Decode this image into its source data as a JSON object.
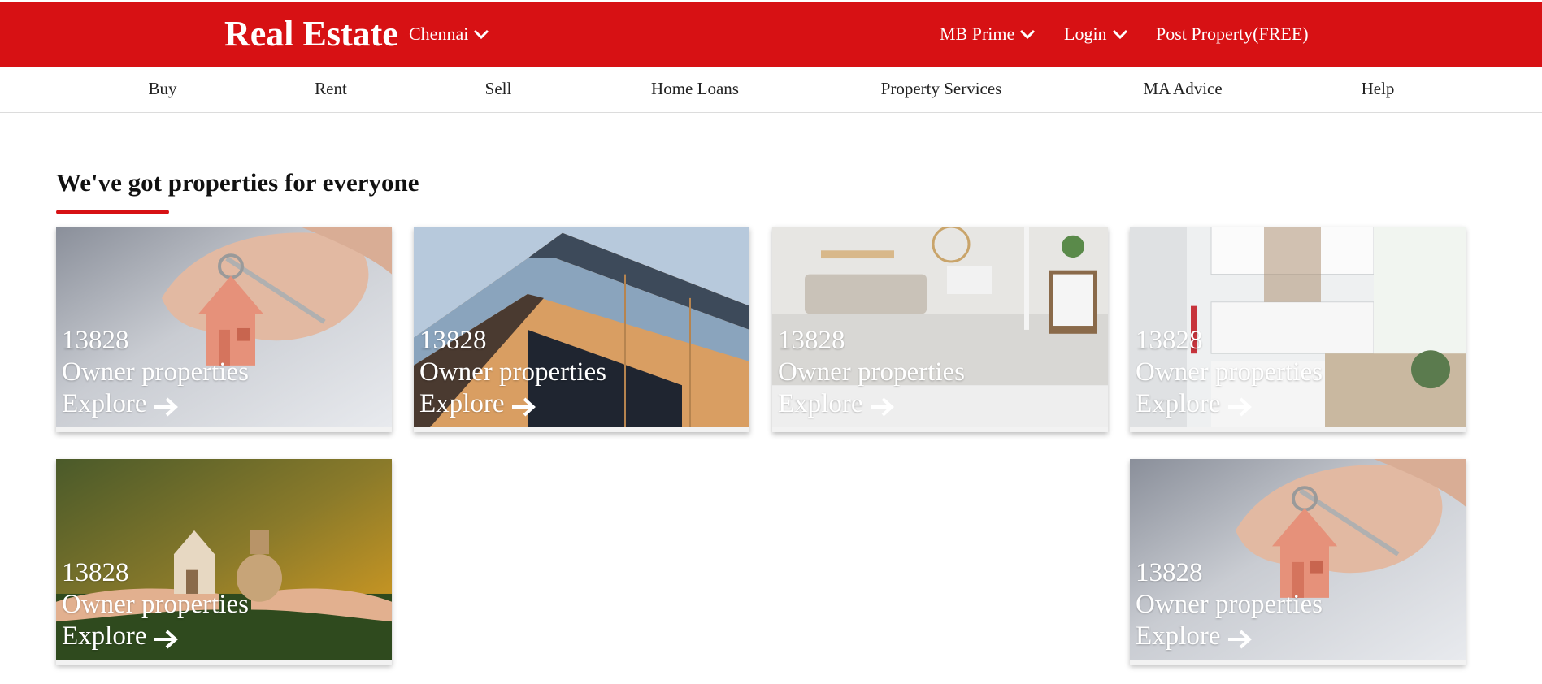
{
  "header": {
    "brand": "Real Estate",
    "city": "Chennai",
    "menu": [
      {
        "label": "MB Prime",
        "dropdown": true
      },
      {
        "label": "Login",
        "dropdown": true
      },
      {
        "label": "Post Property(FREE)",
        "dropdown": false
      }
    ],
    "background_color": "#d71114"
  },
  "nav": {
    "items": [
      "Buy",
      "Rent",
      "Sell",
      "Home Loans",
      "Property Services",
      "MA Advice",
      "Help"
    ]
  },
  "section": {
    "title": "We've got properties for everyone",
    "accent_color": "#d71114"
  },
  "cards": [
    {
      "count": "13828",
      "label": "Owner properties",
      "cta": "Explore",
      "image": "hand-holding-house-keychain"
    },
    {
      "count": "13828",
      "label": "Owner properties",
      "cta": "Explore",
      "image": "modern-building-facade"
    },
    {
      "count": "13828",
      "label": "Owner properties",
      "cta": "Explore",
      "image": "living-room-interior"
    },
    {
      "count": "13828",
      "label": "Owner properties",
      "cta": "Explore",
      "image": "white-kitchen-interior"
    },
    {
      "count": "13828",
      "label": "Owner properties",
      "cta": "Explore",
      "image": "house-and-money-bag-hands"
    },
    {
      "count": "13828",
      "label": "Owner properties",
      "cta": "Explore",
      "image": "hand-holding-house-keychain"
    }
  ]
}
